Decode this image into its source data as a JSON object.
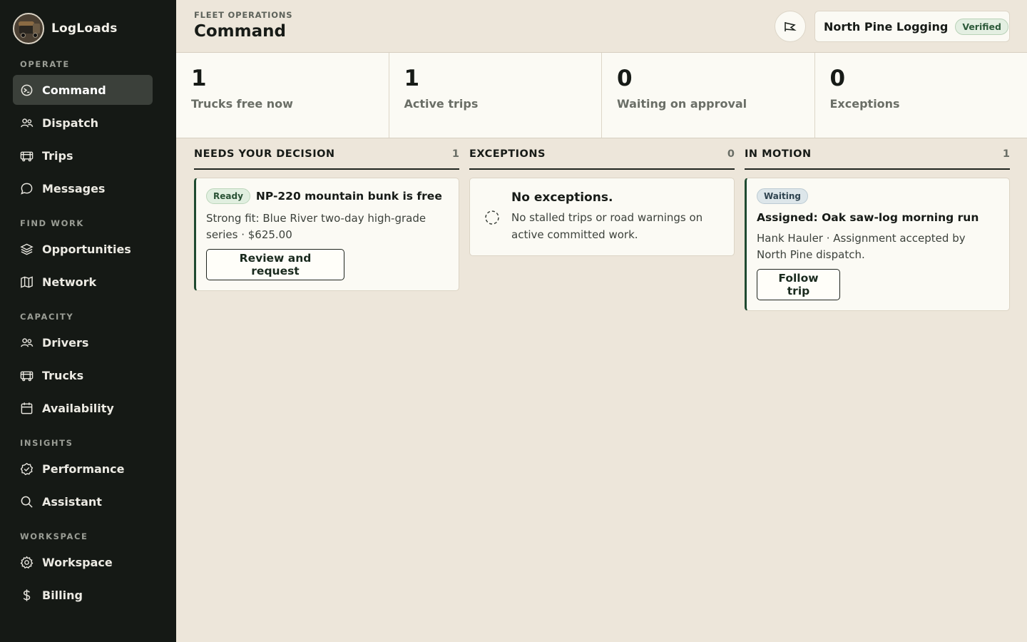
{
  "brand": {
    "name": "LogLoads"
  },
  "sidebar": {
    "sections": [
      {
        "label": "OPERATE"
      },
      {
        "label": "FIND WORK"
      },
      {
        "label": "CAPACITY"
      },
      {
        "label": "INSIGHTS"
      },
      {
        "label": "WORKSPACE"
      }
    ],
    "items": [
      {
        "label": "Command",
        "icon": "command-icon",
        "active": true
      },
      {
        "label": "Dispatch",
        "icon": "people-icon"
      },
      {
        "label": "Trips",
        "icon": "truck-icon"
      },
      {
        "label": "Messages",
        "icon": "chat-icon"
      },
      {
        "label": "Opportunities",
        "icon": "layers-icon"
      },
      {
        "label": "Network",
        "icon": "map-icon"
      },
      {
        "label": "Drivers",
        "icon": "people-icon"
      },
      {
        "label": "Trucks",
        "icon": "truck-icon"
      },
      {
        "label": "Availability",
        "icon": "calendar-icon"
      },
      {
        "label": "Performance",
        "icon": "badge-check-icon"
      },
      {
        "label": "Assistant",
        "icon": "search-icon"
      },
      {
        "label": "Workspace",
        "icon": "gear-icon"
      },
      {
        "label": "Billing",
        "icon": "dollar-icon"
      }
    ]
  },
  "header": {
    "eyebrow": "FLEET OPERATIONS",
    "title": "Command",
    "org_name": "North Pine Logging",
    "org_badge": "Verified"
  },
  "stats": [
    {
      "value": "1",
      "label": "Trucks free now"
    },
    {
      "value": "1",
      "label": "Active trips"
    },
    {
      "value": "0",
      "label": "Waiting on approval"
    },
    {
      "value": "0",
      "label": "Exceptions"
    }
  ],
  "columns": {
    "decision": {
      "title": "NEEDS YOUR DECISION",
      "count": "1",
      "card": {
        "badge": "Ready",
        "title": "NP-220 mountain bunk is free",
        "text_line1": "Strong fit: Blue River two-day high-grade",
        "text_line2": "series · $625.00",
        "button": "Review and request"
      }
    },
    "exceptions": {
      "title": "EXCEPTIONS",
      "count": "0",
      "card": {
        "title": "No exceptions.",
        "text_line1": "No stalled trips or road warnings on",
        "text_line2": "active committed work."
      }
    },
    "motion": {
      "title": "IN MOTION",
      "count": "1",
      "card": {
        "badge": "Waiting",
        "title": "Assigned: Oak saw-log morning run",
        "text_line1": "Hank Hauler · Assignment accepted by",
        "text_line2": "North Pine dispatch.",
        "button": "Follow trip"
      }
    }
  },
  "colors": {
    "sidebar_bg": "#151915",
    "page_bg": "#ede6da",
    "card_bg": "#fbfaf4",
    "accent_green": "#1f4a30"
  }
}
